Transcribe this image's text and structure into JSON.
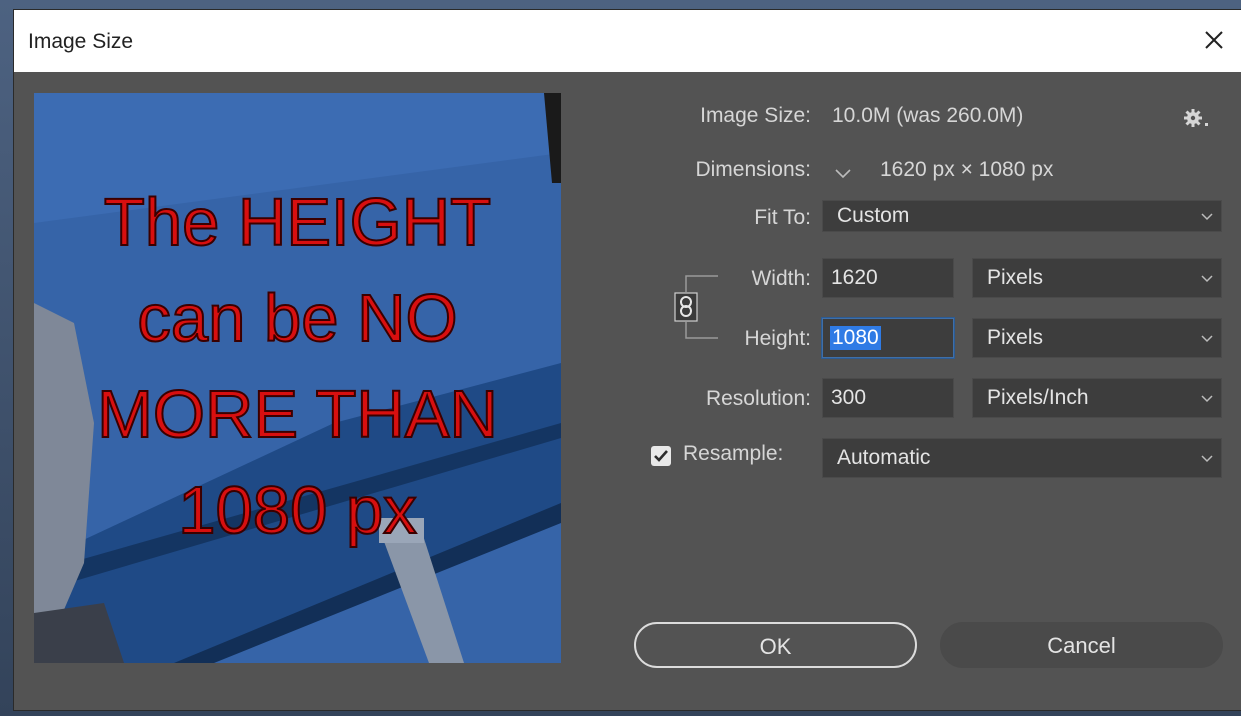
{
  "dialog": {
    "title": "Image Size"
  },
  "preview": {
    "lines": [
      "The HEIGHT",
      "can be NO",
      "MORE THAN",
      "1080 px"
    ]
  },
  "info": {
    "image_size_label": "Image Size:",
    "image_size_value": "10.0M (was 260.0M)",
    "dimensions_label": "Dimensions:",
    "dimensions_value": "1620 px  ×  1080 px"
  },
  "fit_to": {
    "label": "Fit To:",
    "value": "Custom"
  },
  "width": {
    "label": "Width:",
    "value": "1620",
    "unit": "Pixels"
  },
  "height": {
    "label": "Height:",
    "value": "1080",
    "unit": "Pixels"
  },
  "resolution": {
    "label": "Resolution:",
    "value": "300",
    "unit": "Pixels/Inch"
  },
  "resample": {
    "label": "Resample:",
    "checked": true,
    "value": "Automatic"
  },
  "buttons": {
    "ok": "OK",
    "cancel": "Cancel"
  },
  "icons": {
    "close": "close-icon",
    "settings": "gear-icon",
    "dimensions_toggle": "chevron-down-icon",
    "constrain": "link-icon",
    "dropdown": "chevron-down-icon",
    "check": "checkmark-icon"
  }
}
